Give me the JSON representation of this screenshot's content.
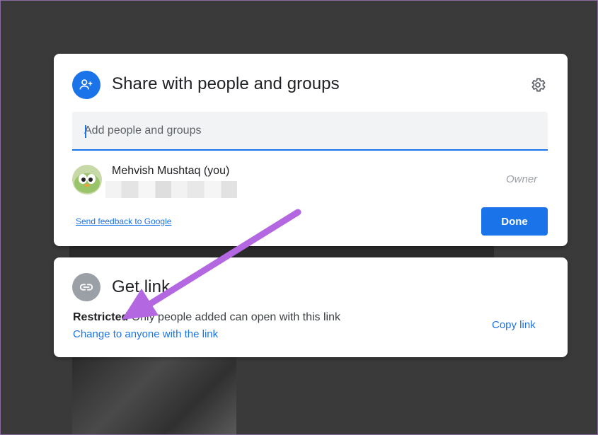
{
  "share_dialog": {
    "title": "Share with people and groups",
    "icon": "person-add-icon",
    "settings_icon": "gear-icon",
    "add_people": {
      "placeholder": "Add people and groups",
      "value": ""
    },
    "user": {
      "name": "Mehvish Mushtaq (you)",
      "role": "Owner"
    },
    "feedback_link": "Send feedback to Google",
    "done_label": "Done"
  },
  "link_dialog": {
    "title": "Get link",
    "icon": "link-icon",
    "access_level": "Restricted",
    "access_description": "Only people added can open with this link",
    "change_link": "Change to anyone with the link",
    "copy_link": "Copy link"
  },
  "colors": {
    "accent": "#1a73e8",
    "backdrop": "#3a3a3a",
    "annotation_arrow": "#b367e0"
  }
}
